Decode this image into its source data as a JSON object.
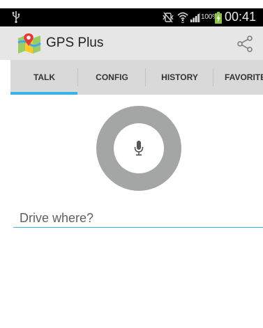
{
  "status_bar": {
    "battery_percent": "100%",
    "time": "00:41",
    "icons": [
      "usb-icon",
      "mute-icon",
      "wifi-icon",
      "signal-icon",
      "battery-charging-icon"
    ]
  },
  "app_bar": {
    "title": "GPS Plus",
    "logo_icon": "map-logo-icon",
    "share_icon": "share-icon"
  },
  "tabs": [
    {
      "label": "TALK",
      "selected": true
    },
    {
      "label": "CONFIG",
      "selected": false
    },
    {
      "label": "HISTORY",
      "selected": false
    },
    {
      "label": "FAVORITE",
      "selected": false
    }
  ],
  "voice": {
    "icon": "microphone-icon"
  },
  "destination": {
    "placeholder": "Drive where?",
    "value": ""
  },
  "colors": {
    "accent": "#33b5e5",
    "status_bar": "#000000",
    "action_bar": "#e6e6e6",
    "tab_bar": "#d9d9d9",
    "mic_ring": "#a4a6a5"
  }
}
